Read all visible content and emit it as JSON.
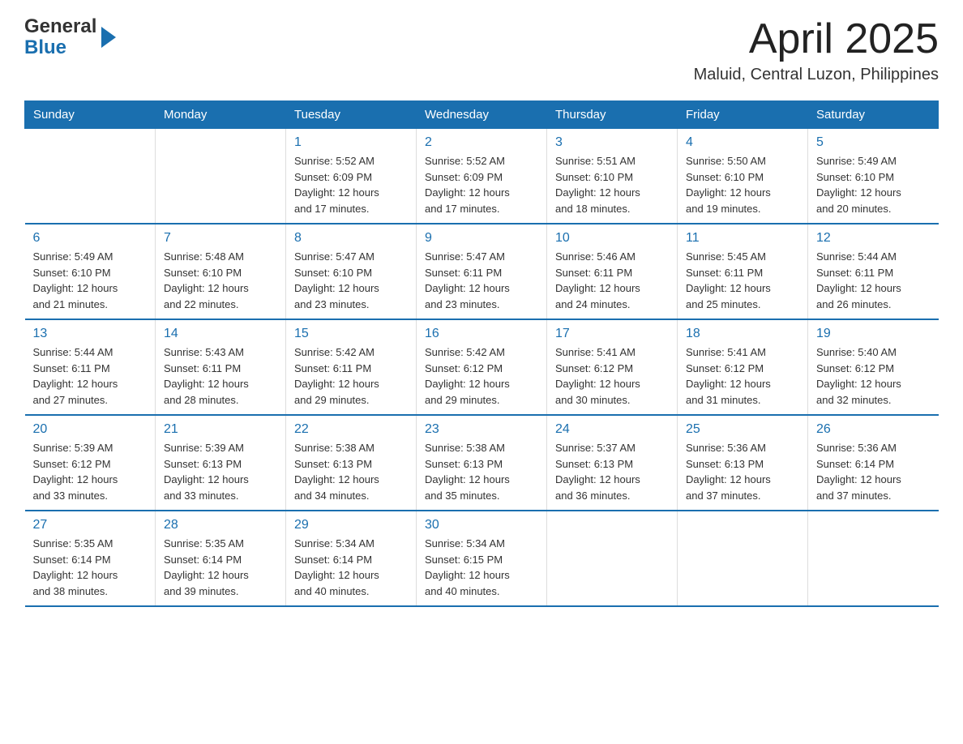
{
  "header": {
    "logo_general": "General",
    "logo_blue": "Blue",
    "title": "April 2025",
    "subtitle": "Maluid, Central Luzon, Philippines"
  },
  "calendar": {
    "days_of_week": [
      "Sunday",
      "Monday",
      "Tuesday",
      "Wednesday",
      "Thursday",
      "Friday",
      "Saturday"
    ],
    "weeks": [
      [
        {
          "day": "",
          "info": ""
        },
        {
          "day": "",
          "info": ""
        },
        {
          "day": "1",
          "info": "Sunrise: 5:52 AM\nSunset: 6:09 PM\nDaylight: 12 hours\nand 17 minutes."
        },
        {
          "day": "2",
          "info": "Sunrise: 5:52 AM\nSunset: 6:09 PM\nDaylight: 12 hours\nand 17 minutes."
        },
        {
          "day": "3",
          "info": "Sunrise: 5:51 AM\nSunset: 6:10 PM\nDaylight: 12 hours\nand 18 minutes."
        },
        {
          "day": "4",
          "info": "Sunrise: 5:50 AM\nSunset: 6:10 PM\nDaylight: 12 hours\nand 19 minutes."
        },
        {
          "day": "5",
          "info": "Sunrise: 5:49 AM\nSunset: 6:10 PM\nDaylight: 12 hours\nand 20 minutes."
        }
      ],
      [
        {
          "day": "6",
          "info": "Sunrise: 5:49 AM\nSunset: 6:10 PM\nDaylight: 12 hours\nand 21 minutes."
        },
        {
          "day": "7",
          "info": "Sunrise: 5:48 AM\nSunset: 6:10 PM\nDaylight: 12 hours\nand 22 minutes."
        },
        {
          "day": "8",
          "info": "Sunrise: 5:47 AM\nSunset: 6:10 PM\nDaylight: 12 hours\nand 23 minutes."
        },
        {
          "day": "9",
          "info": "Sunrise: 5:47 AM\nSunset: 6:11 PM\nDaylight: 12 hours\nand 23 minutes."
        },
        {
          "day": "10",
          "info": "Sunrise: 5:46 AM\nSunset: 6:11 PM\nDaylight: 12 hours\nand 24 minutes."
        },
        {
          "day": "11",
          "info": "Sunrise: 5:45 AM\nSunset: 6:11 PM\nDaylight: 12 hours\nand 25 minutes."
        },
        {
          "day": "12",
          "info": "Sunrise: 5:44 AM\nSunset: 6:11 PM\nDaylight: 12 hours\nand 26 minutes."
        }
      ],
      [
        {
          "day": "13",
          "info": "Sunrise: 5:44 AM\nSunset: 6:11 PM\nDaylight: 12 hours\nand 27 minutes."
        },
        {
          "day": "14",
          "info": "Sunrise: 5:43 AM\nSunset: 6:11 PM\nDaylight: 12 hours\nand 28 minutes."
        },
        {
          "day": "15",
          "info": "Sunrise: 5:42 AM\nSunset: 6:11 PM\nDaylight: 12 hours\nand 29 minutes."
        },
        {
          "day": "16",
          "info": "Sunrise: 5:42 AM\nSunset: 6:12 PM\nDaylight: 12 hours\nand 29 minutes."
        },
        {
          "day": "17",
          "info": "Sunrise: 5:41 AM\nSunset: 6:12 PM\nDaylight: 12 hours\nand 30 minutes."
        },
        {
          "day": "18",
          "info": "Sunrise: 5:41 AM\nSunset: 6:12 PM\nDaylight: 12 hours\nand 31 minutes."
        },
        {
          "day": "19",
          "info": "Sunrise: 5:40 AM\nSunset: 6:12 PM\nDaylight: 12 hours\nand 32 minutes."
        }
      ],
      [
        {
          "day": "20",
          "info": "Sunrise: 5:39 AM\nSunset: 6:12 PM\nDaylight: 12 hours\nand 33 minutes."
        },
        {
          "day": "21",
          "info": "Sunrise: 5:39 AM\nSunset: 6:13 PM\nDaylight: 12 hours\nand 33 minutes."
        },
        {
          "day": "22",
          "info": "Sunrise: 5:38 AM\nSunset: 6:13 PM\nDaylight: 12 hours\nand 34 minutes."
        },
        {
          "day": "23",
          "info": "Sunrise: 5:38 AM\nSunset: 6:13 PM\nDaylight: 12 hours\nand 35 minutes."
        },
        {
          "day": "24",
          "info": "Sunrise: 5:37 AM\nSunset: 6:13 PM\nDaylight: 12 hours\nand 36 minutes."
        },
        {
          "day": "25",
          "info": "Sunrise: 5:36 AM\nSunset: 6:13 PM\nDaylight: 12 hours\nand 37 minutes."
        },
        {
          "day": "26",
          "info": "Sunrise: 5:36 AM\nSunset: 6:14 PM\nDaylight: 12 hours\nand 37 minutes."
        }
      ],
      [
        {
          "day": "27",
          "info": "Sunrise: 5:35 AM\nSunset: 6:14 PM\nDaylight: 12 hours\nand 38 minutes."
        },
        {
          "day": "28",
          "info": "Sunrise: 5:35 AM\nSunset: 6:14 PM\nDaylight: 12 hours\nand 39 minutes."
        },
        {
          "day": "29",
          "info": "Sunrise: 5:34 AM\nSunset: 6:14 PM\nDaylight: 12 hours\nand 40 minutes."
        },
        {
          "day": "30",
          "info": "Sunrise: 5:34 AM\nSunset: 6:15 PM\nDaylight: 12 hours\nand 40 minutes."
        },
        {
          "day": "",
          "info": ""
        },
        {
          "day": "",
          "info": ""
        },
        {
          "day": "",
          "info": ""
        }
      ]
    ]
  }
}
